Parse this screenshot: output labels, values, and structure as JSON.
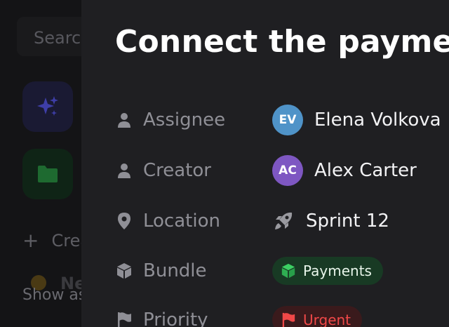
{
  "background": {
    "search_placeholder": "Search",
    "create_label": "Create",
    "new_label": "New",
    "show_label": "Show as"
  },
  "modal": {
    "title": "Connect the payment",
    "fields": [
      {
        "label": "Assignee",
        "icon": "person-icon",
        "value": "Elena Volkova",
        "initials": "EV",
        "avatar_color": "#4f93c8"
      },
      {
        "label": "Creator",
        "icon": "person-icon",
        "value": "Alex Carter",
        "initials": "AC",
        "avatar_color": "#7e57c2"
      },
      {
        "label": "Location",
        "icon": "location-pin-icon",
        "value": "Sprint 12",
        "value_icon": "rocket-icon"
      },
      {
        "label": "Bundle",
        "icon": "cube-icon",
        "value": "Payments",
        "value_icon": "cube-icon",
        "pill_color": "#183a24"
      },
      {
        "label": "Priority",
        "icon": "flag-icon",
        "value": "Urgent",
        "value_icon": "flag-icon",
        "pill_color": "#3a1a1c",
        "text_color": "#f04848"
      }
    ]
  }
}
